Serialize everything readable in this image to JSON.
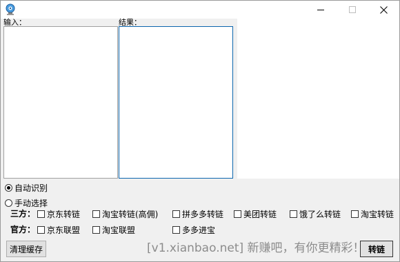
{
  "window": {
    "icon": "globe-webcam-icon",
    "controls": {
      "minimize": "minimize-icon",
      "maximize": "maximize-icon",
      "close": "close-icon"
    }
  },
  "input": {
    "label": "输入：",
    "value": ""
  },
  "output": {
    "label": "结果：",
    "value": ""
  },
  "mode": {
    "auto_label": "自动识别",
    "auto_selected": true,
    "manual_label": "手动选择",
    "manual_selected": false
  },
  "third_party": {
    "label": "三方：",
    "options": [
      {
        "label": "京东转链",
        "checked": false
      },
      {
        "label": "淘宝转链(高佣)",
        "checked": false
      },
      {
        "label": "拼多多转链",
        "checked": false
      },
      {
        "label": "美团转链",
        "checked": false
      },
      {
        "label": "饿了么转链",
        "checked": false
      },
      {
        "label": "淘宝转链",
        "checked": false
      }
    ]
  },
  "official": {
    "label": "官方：",
    "options": [
      {
        "label": "京东联盟",
        "checked": false
      },
      {
        "label": "淘宝联盟",
        "checked": false
      },
      {
        "label": "多多进宝",
        "checked": false
      }
    ]
  },
  "buttons": {
    "clear": "清理缓存",
    "convert": "转链"
  },
  "watermark": "[v1.xianbao.net] 新赚吧，有你更精彩！",
  "colors": {
    "focus_border": "#0a64ad",
    "panel_bg": "#f0f0f0"
  }
}
